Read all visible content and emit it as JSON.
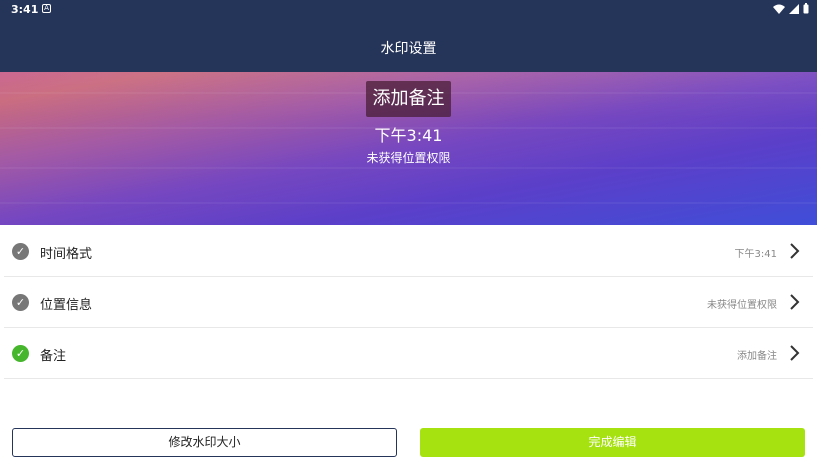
{
  "status_bar": {
    "time": "3:41",
    "notification_icon": "a-icon",
    "icons": [
      "wifi-icon",
      "signal-icon",
      "battery-icon"
    ]
  },
  "app_bar": {
    "title": "水印设置"
  },
  "preview": {
    "note_text": "添加备注",
    "time_text": "下午3:41",
    "location_text": "未获得位置权限"
  },
  "settings": [
    {
      "label": "时间格式",
      "value": "下午3:41",
      "checked": false
    },
    {
      "label": "位置信息",
      "value": "未获得位置权限",
      "checked": false
    },
    {
      "label": "备注",
      "value": "添加备注",
      "checked": true
    }
  ],
  "buttons": {
    "resize_label": "修改水印大小",
    "done_label": "完成编辑"
  },
  "colors": {
    "header_bg": "#253459",
    "done_button": "#a6e210",
    "check_active": "#46b62c",
    "check_inactive": "#777777"
  }
}
